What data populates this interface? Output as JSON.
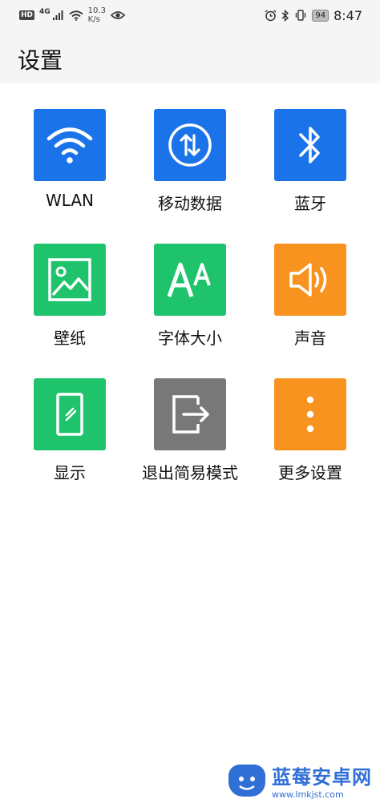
{
  "status_bar": {
    "hd": "HD",
    "network": "4G",
    "speed_value": "10.3",
    "speed_unit": "K/s",
    "battery": "94",
    "time": "8:47"
  },
  "header": {
    "title": "设置"
  },
  "tiles": [
    {
      "label": "WLAN",
      "icon": "wifi-icon",
      "color": "#1a73e8"
    },
    {
      "label": "移动数据",
      "icon": "mobile-data-icon",
      "color": "#1a73e8"
    },
    {
      "label": "蓝牙",
      "icon": "bluetooth-icon",
      "color": "#1a73e8"
    },
    {
      "label": "壁纸",
      "icon": "wallpaper-icon",
      "color": "#1fc36b"
    },
    {
      "label": "字体大小",
      "icon": "font-size-icon",
      "color": "#1fc36b"
    },
    {
      "label": "声音",
      "icon": "sound-icon",
      "color": "#f7931e"
    },
    {
      "label": "显示",
      "icon": "display-icon",
      "color": "#1fc36b"
    },
    {
      "label": "退出简易模式",
      "icon": "exit-icon",
      "color": "#787878"
    },
    {
      "label": "更多设置",
      "icon": "more-icon",
      "color": "#f7931e"
    }
  ],
  "watermark": {
    "title": "蓝莓安卓网",
    "url": "www.lmkjst.com"
  }
}
